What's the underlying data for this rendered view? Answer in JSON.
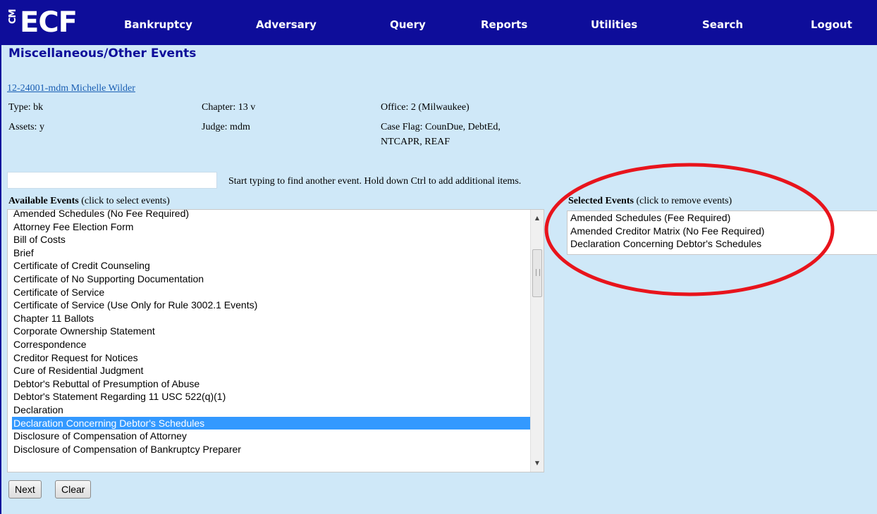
{
  "nav": {
    "logo": "ECF",
    "logo_prefix": "CM",
    "items": [
      {
        "label": "Bankruptcy",
        "key": "n"
      },
      {
        "label": "Adversary",
        "key": "y"
      },
      {
        "label": "Query",
        "key": "Q"
      },
      {
        "label": "Reports",
        "key": ""
      },
      {
        "label": "Utilities",
        "key": "U"
      },
      {
        "label": "Search",
        "key": "S"
      },
      {
        "label": "Logout",
        "key": ""
      }
    ],
    "color": "#0e0d9a"
  },
  "page_title": "Miscellaneous/Other Events",
  "case": {
    "link": "12-24001-mdm Michelle Wilder",
    "type": "Type: bk",
    "chapter": "Chapter: 13 v",
    "office": "Office: 2 (Milwaukee)",
    "assets": "Assets: y",
    "judge": "Judge: mdm",
    "case_flag_1": "Case Flag: CounDue, DebtEd,",
    "case_flag_2": "NTCAPR, REAF"
  },
  "search": {
    "value": "",
    "hint": "Start typing to find another event. Hold down Ctrl to add additional items."
  },
  "available": {
    "title": "Available Events",
    "subtitle": "(click to select events)",
    "items": [
      "Amended Schedules (No Fee Required)",
      "Attorney Fee Election Form",
      "Bill of Costs",
      "Brief",
      "Certificate of Credit Counseling",
      "Certificate of No Supporting Documentation",
      "Certificate of Service",
      "Certificate of Service (Use Only for Rule 3002.1 Events)",
      "Chapter 11 Ballots",
      "Corporate Ownership Statement",
      "Correspondence",
      "Creditor Request for Notices",
      "Cure of Residential Judgment",
      "Debtor's Rebuttal of Presumption of Abuse",
      "Debtor's Statement Regarding 11 USC 522(q)(1)",
      "Declaration",
      "Declaration Concerning Debtor's Schedules",
      "Disclosure of Compensation of Attorney",
      "Disclosure of Compensation of Bankruptcy Preparer"
    ],
    "highlighted": "Declaration Concerning Debtor's Schedules"
  },
  "selected": {
    "title": "Selected Events",
    "subtitle": "(click to remove events)",
    "items": [
      "Amended Schedules (Fee Required)",
      "Amended Creditor Matrix (No Fee Required)",
      "Declaration Concerning Debtor's Schedules"
    ]
  },
  "buttons": {
    "next": "Next",
    "clear": "Clear"
  },
  "colors": {
    "background": "#cfe8f8",
    "highlight": "#3399ff",
    "annotation": "#e8141c"
  }
}
